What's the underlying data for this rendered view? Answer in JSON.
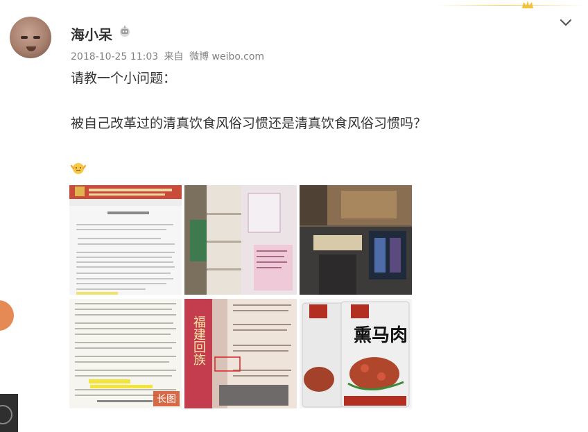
{
  "post": {
    "username": "海小呆",
    "timestamp": "2018-10-25 11:03",
    "source_prefix": "来自",
    "source": "微博 weibo.com",
    "text_line1": "请教一个小问题：",
    "text_line2": "被自己改革过的清真饮食风俗习惯还是清真饮食风俗习惯吗？",
    "emoji": "shrug-emoji"
  },
  "images": [
    {
      "name": "document-scan-1",
      "caption": ""
    },
    {
      "name": "shop-shelves-photo",
      "caption": ""
    },
    {
      "name": "street-storefront-collage",
      "caption": ""
    },
    {
      "name": "document-scan-2",
      "caption": "",
      "tag": "长图"
    },
    {
      "name": "book-pages-photo",
      "caption": "福建回族"
    },
    {
      "name": "meat-packaging-photo",
      "caption": "熏马肉"
    }
  ],
  "icons": {
    "badge": "robot-badge-icon",
    "menu": "chevron-down-icon",
    "crown": "crown-icon"
  },
  "colors": {
    "accent": "#f0c040",
    "tag_bg": "#d25028",
    "meta": "#808080"
  }
}
